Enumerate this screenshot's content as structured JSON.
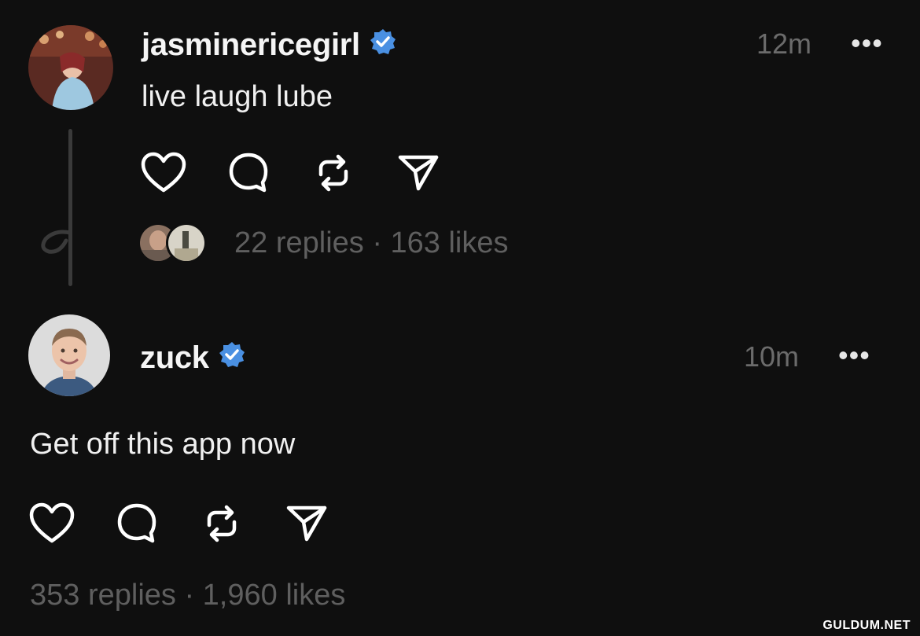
{
  "colors": {
    "background": "#0f0f0f",
    "verified_badge": "#4a90e2",
    "muted_text": "#5f5f5f",
    "icon_stroke": "#ffffff"
  },
  "posts": [
    {
      "username": "jasminericegirl",
      "verified": true,
      "timestamp": "12m",
      "more_label": "•••",
      "text": "live laugh lube",
      "actions": [
        "heart-icon",
        "comment-icon",
        "repost-icon",
        "share-icon"
      ],
      "stats": "22 replies · 163 likes"
    },
    {
      "username": "zuck",
      "verified": true,
      "timestamp": "10m",
      "more_label": "•••",
      "text": "Get off this app now",
      "actions": [
        "heart-icon",
        "comment-icon",
        "repost-icon",
        "share-icon"
      ],
      "stats": "353 replies · 1,960 likes"
    }
  ],
  "watermark": "GULDUM.NET"
}
